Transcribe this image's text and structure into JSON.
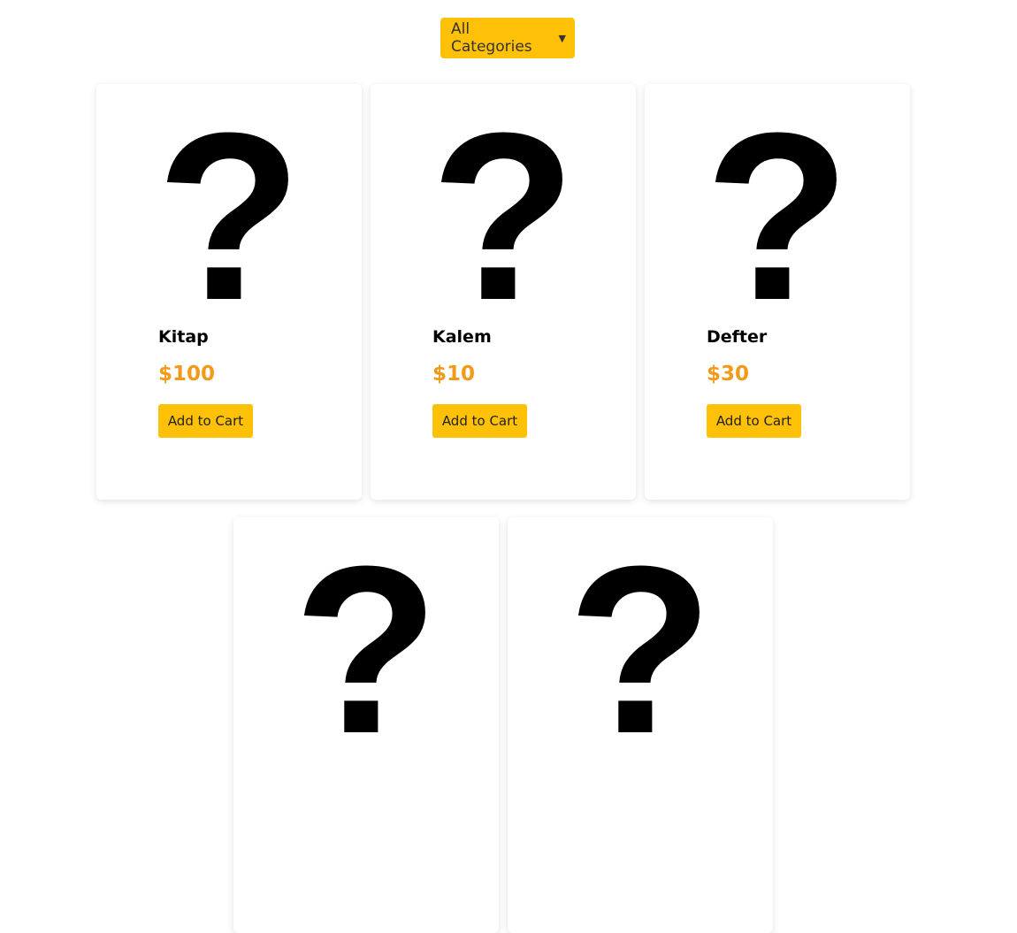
{
  "filter": {
    "selected": "All Categories",
    "chevron_icon": "chevron-down-icon"
  },
  "theme": {
    "accent": "#ffc107",
    "price_color": "#f29a1c"
  },
  "product_image_icon": "question-mark-icon",
  "products": [
    {
      "name": "Kitap",
      "price": "$100",
      "button": "Add to Cart"
    },
    {
      "name": "Kalem",
      "price": "$10",
      "button": "Add to Cart"
    },
    {
      "name": "Defter",
      "price": "$30",
      "button": "Add to Cart"
    },
    {
      "name": "",
      "price": "",
      "button": ""
    },
    {
      "name": "",
      "price": "",
      "button": ""
    }
  ]
}
